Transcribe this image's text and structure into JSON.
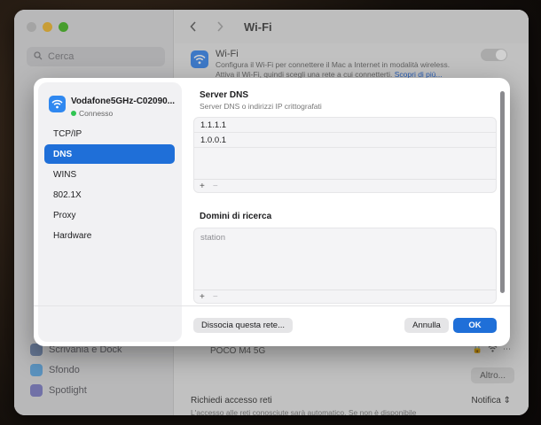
{
  "window": {
    "search_placeholder": "Cerca",
    "title": "Wi-Fi",
    "sidebar_items": [
      {
        "label": "Scrivania e Dock"
      },
      {
        "label": "Sfondo"
      },
      {
        "label": "Spotlight"
      }
    ],
    "wifi": {
      "title": "Wi-Fi",
      "description": "Configura il Wi-Fi per connettere il Mac a Internet in modalità wireless. Attiva il Wi-Fi, quindi scegli una rete a cui connetterti.",
      "link": "Scopri di più..."
    },
    "network_row": "POCO M4 5G",
    "altro_button": "Altro...",
    "ask_access": {
      "title": "Richiedi accesso reti",
      "description": "L'accesso alle reti conosciute sarà automatico. Se non è disponibile",
      "value": "Notifica"
    }
  },
  "sheet": {
    "network_name": "Vodafone5GHz-C02090...",
    "network_status": "Connesso",
    "tabs": [
      {
        "label": "TCP/IP",
        "active": false
      },
      {
        "label": "DNS",
        "active": true
      },
      {
        "label": "WINS",
        "active": false
      },
      {
        "label": "802.1X",
        "active": false
      },
      {
        "label": "Proxy",
        "active": false
      },
      {
        "label": "Hardware",
        "active": false
      }
    ],
    "dns": {
      "title": "Server DNS",
      "subtitle": "Server DNS o indirizzi IP crittografati",
      "servers": [
        "1.1.1.1",
        "1.0.0.1"
      ]
    },
    "search_domains": {
      "title": "Domini di ricerca",
      "placeholder": "station"
    },
    "add_symbol": "+",
    "remove_symbol": "−",
    "forget_button": "Dissocia questa rete...",
    "cancel_button": "Annulla",
    "ok_button": "OK"
  },
  "colors": {
    "accent": "#1f6fd8",
    "connected": "#31c553",
    "wifi_icon": "#2f88f0"
  }
}
